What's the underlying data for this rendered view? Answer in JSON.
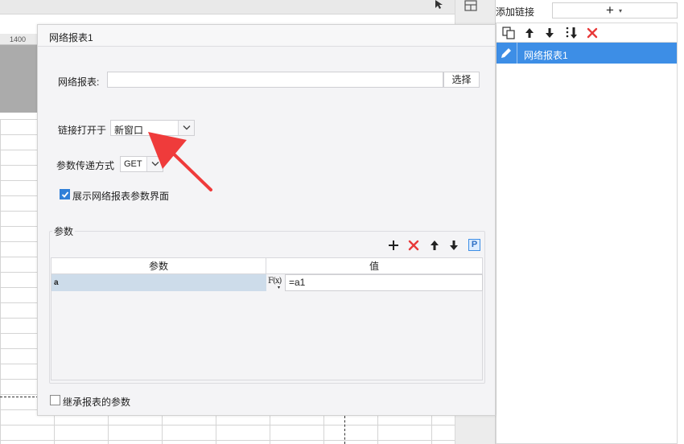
{
  "background": {
    "ruler_label": "1400"
  },
  "right_panel": {
    "title": "添加链接",
    "add_symbol": "+",
    "add_caret": "▾",
    "toolbar": [
      "copy-icon",
      "arrow-up-icon",
      "arrow-down-icon",
      "sort-down-icon",
      "delete-icon"
    ],
    "items": [
      {
        "label": "网络报表1",
        "selected": true
      }
    ]
  },
  "dialog": {
    "title": "网络报表1",
    "report_label": "网络报表:",
    "report_value": "",
    "select_label": "选择",
    "open_in_label": "链接打开于",
    "open_in_value": "新窗口",
    "method_label": "参数传递方式",
    "method_value": "GET",
    "show_params_label": "展示网络报表参数界面",
    "show_params_checked": true,
    "params_group_label": "参数",
    "params_toolbar": [
      "plus-icon",
      "delete-icon",
      "arrow-up-icon",
      "arrow-down-icon",
      "p-icon"
    ],
    "p_button_label": "P",
    "table": {
      "col_param": "参数",
      "col_value": "值",
      "rows": [
        {
          "name": "a",
          "fx": "F(x)",
          "value": "=a1"
        }
      ]
    },
    "inherit_label": "继承报表的参数",
    "inherit_checked": false
  },
  "colors": {
    "accent": "#3d8ee6",
    "delete_red": "#e83a3a",
    "annotation_arrow": "#ef3b3b"
  }
}
